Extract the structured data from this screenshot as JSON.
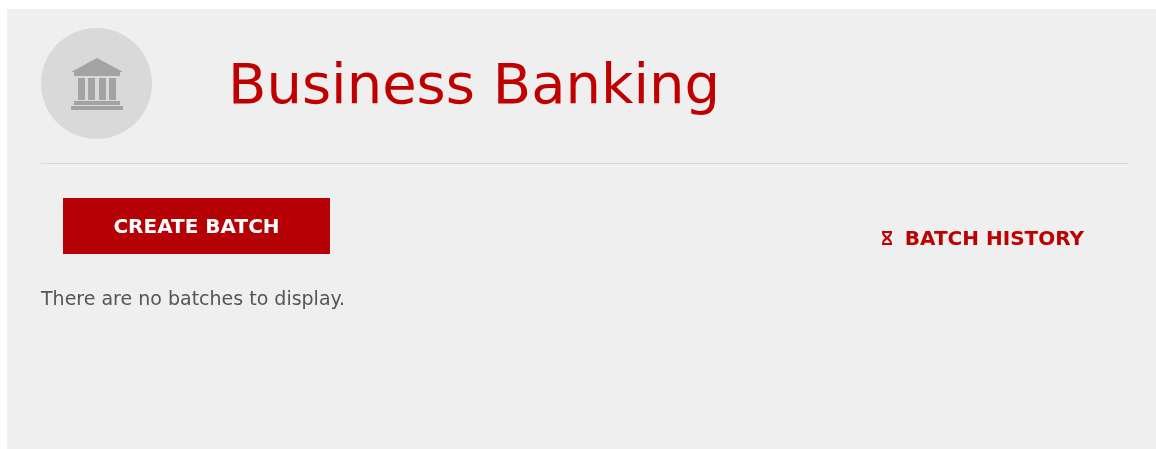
{
  "header": {
    "title": "Business Banking"
  },
  "actions": {
    "create_button": "CREATE BATCH",
    "history_link": "BATCH HISTORY"
  },
  "empty_message": "There are no batches to display."
}
